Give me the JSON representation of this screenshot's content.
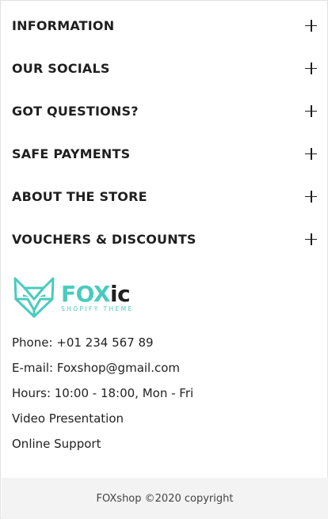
{
  "accordion": {
    "items": [
      {
        "label": "INFORMATION"
      },
      {
        "label": "OUR SOCIALS"
      },
      {
        "label": "GOT QUESTIONS?"
      },
      {
        "label": "SAFE PAYMENTS"
      },
      {
        "label": "ABOUT THE STORE"
      },
      {
        "label": "VOUCHERS & DISCOUNTS"
      }
    ],
    "toggle_icon": "plus-icon"
  },
  "logo": {
    "word_fox": "FOX",
    "word_ic": "ic",
    "tagline": "SHOPIFY THEME",
    "icon": "fox-head-icon",
    "accent_color": "#49cbbd"
  },
  "contacts": {
    "phone": "Phone: +01 234 567 89",
    "email": "E-mail: Foxshop@gmail.com",
    "hours": "Hours: 10:00 - 18:00, Mon - Fri",
    "video": "Video Presentation",
    "support": "Online Support"
  },
  "footer": {
    "copyright": "FOXshop ©2020 copyright"
  }
}
